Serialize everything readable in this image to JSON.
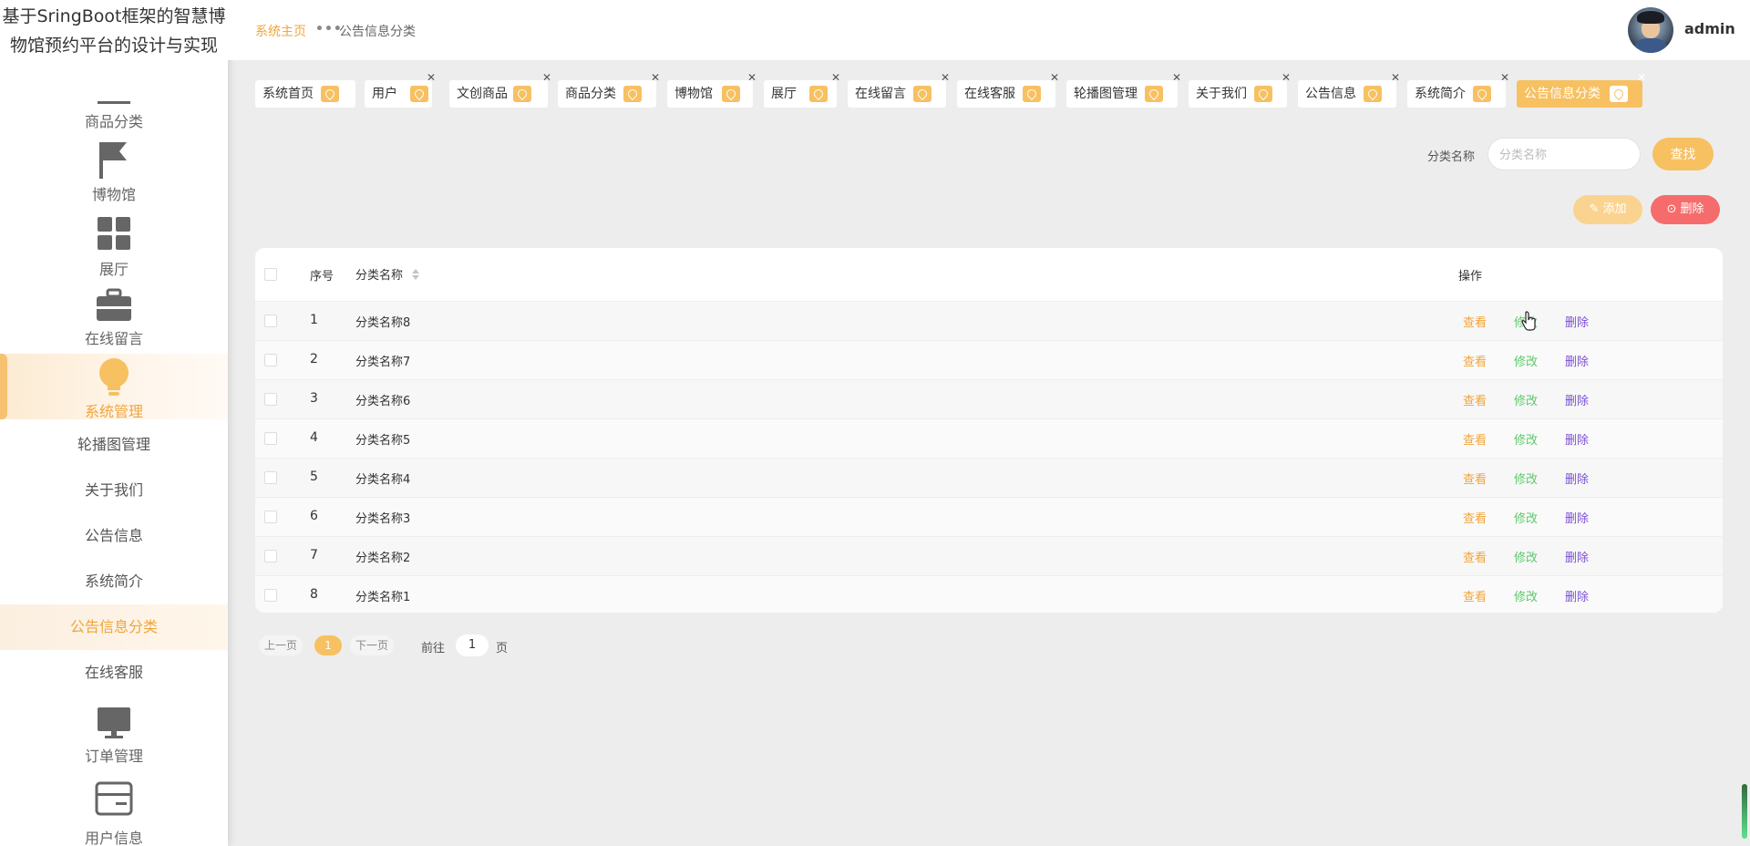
{
  "app": {
    "title": "基于SringBoot框架的智慧博物馆预约平台的设计与实现"
  },
  "sidebar": {
    "items": [
      {
        "label": "商品分类",
        "icon": "list-icon"
      },
      {
        "label": "博物馆",
        "icon": "flag-icon"
      },
      {
        "label": "展厅",
        "icon": "grid-icon"
      },
      {
        "label": "在线留言",
        "icon": "briefcase-icon"
      },
      {
        "label": "系统管理",
        "icon": "bulb-icon"
      },
      {
        "label": "订单管理",
        "icon": "monitor-icon"
      },
      {
        "label": "用户信息",
        "icon": "card-icon"
      }
    ],
    "sub_items": [
      {
        "label": "轮播图管理"
      },
      {
        "label": "关于我们"
      },
      {
        "label": "公告信息"
      },
      {
        "label": "系统简介"
      },
      {
        "label": "公告信息分类"
      },
      {
        "label": "在线客服"
      }
    ]
  },
  "header": {
    "breadcrumb": {
      "home": "系统主页",
      "separator": "•••",
      "current": "公告信息分类"
    },
    "user": {
      "name": "admin"
    }
  },
  "tabs": [
    {
      "label": "系统首页"
    },
    {
      "label": "用户"
    },
    {
      "label": "文创商品"
    },
    {
      "label": "商品分类"
    },
    {
      "label": "博物馆"
    },
    {
      "label": "展厅"
    },
    {
      "label": "在线留言"
    },
    {
      "label": "在线客服"
    },
    {
      "label": "轮播图管理"
    },
    {
      "label": "关于我们"
    },
    {
      "label": "公告信息"
    },
    {
      "label": "系统简介"
    },
    {
      "label": "公告信息分类"
    }
  ],
  "search": {
    "label": "分类名称",
    "placeholder": "分类名称",
    "button": "查找"
  },
  "actions": {
    "add": "添加",
    "delete": "删除"
  },
  "table": {
    "columns": {
      "index": "序号",
      "name": "分类名称",
      "ops": "操作"
    },
    "rows": [
      {
        "index": "1",
        "name": "分类名称8"
      },
      {
        "index": "2",
        "name": "分类名称7"
      },
      {
        "index": "3",
        "name": "分类名称6"
      },
      {
        "index": "4",
        "name": "分类名称5"
      },
      {
        "index": "5",
        "name": "分类名称4"
      },
      {
        "index": "6",
        "name": "分类名称3"
      },
      {
        "index": "7",
        "name": "分类名称2"
      },
      {
        "index": "8",
        "name": "分类名称1"
      }
    ],
    "ops": {
      "view": "查看",
      "edit": "修改",
      "delete": "删除"
    }
  },
  "pagination": {
    "prev": "上一页",
    "current": "1",
    "next": "下一页",
    "goto_label": "前往",
    "goto_value": "1",
    "page_suffix": "页"
  },
  "colors": {
    "accent": "#f7c061",
    "danger": "#f66c6c",
    "edit": "#5cc96a",
    "delete_link": "#7b4fd4"
  }
}
